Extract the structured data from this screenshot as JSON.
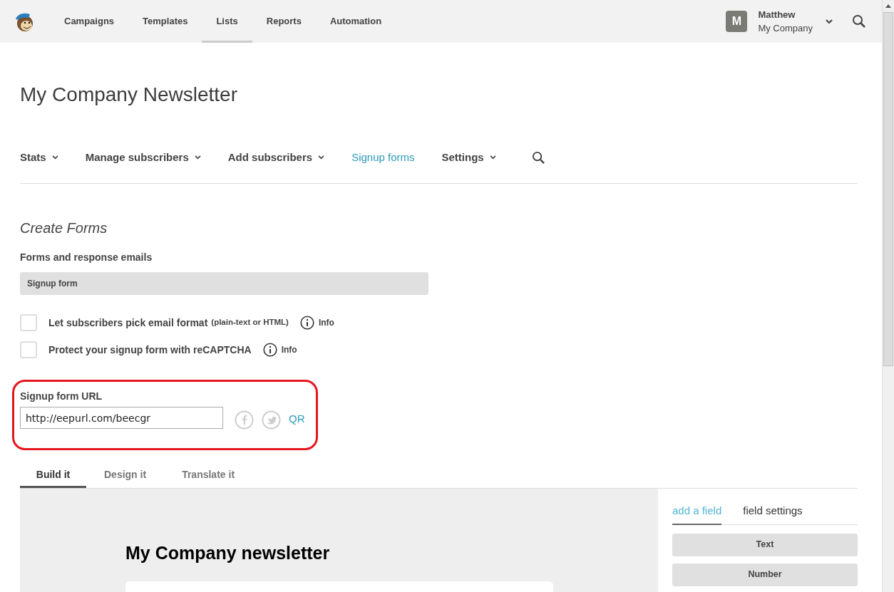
{
  "top_nav": {
    "items": [
      {
        "label": "Campaigns",
        "selected": false
      },
      {
        "label": "Templates",
        "selected": false
      },
      {
        "label": "Lists",
        "selected": true
      },
      {
        "label": "Reports",
        "selected": false
      },
      {
        "label": "Automation",
        "selected": false
      }
    ],
    "account": {
      "initial": "M",
      "name": "Matthew",
      "company": "My Company"
    }
  },
  "page_title": "My Company Newsletter",
  "sub_nav": [
    {
      "label": "Stats",
      "dropdown": true,
      "selected": false
    },
    {
      "label": "Manage subscribers",
      "dropdown": true,
      "selected": false
    },
    {
      "label": "Add subscribers",
      "dropdown": true,
      "selected": false
    },
    {
      "label": "Signup forms",
      "dropdown": false,
      "selected": true
    },
    {
      "label": "Settings",
      "dropdown": true,
      "selected": false
    }
  ],
  "section_title": "Create Forms",
  "form_select": {
    "label": "Forms and response emails",
    "value": "Signup form"
  },
  "options": [
    {
      "label": "Let subscribers pick email format",
      "note": "(plain-text or HTML)",
      "checked": false,
      "info": "Info"
    },
    {
      "label": "Protect your signup form with reCAPTCHA",
      "checked": false,
      "info": "Info"
    }
  ],
  "signup_url": {
    "label": "Signup form URL",
    "value": "http://eepurl.com/beecgr",
    "qr": "QR"
  },
  "builder_tabs": [
    {
      "label": "Build it",
      "selected": true
    },
    {
      "label": "Design it",
      "selected": false
    },
    {
      "label": "Translate it",
      "selected": false
    }
  ],
  "preview": {
    "title": "My Company newsletter"
  },
  "field_panel": {
    "tabs": [
      {
        "label": "add a field",
        "selected": true
      },
      {
        "label": "field settings",
        "selected": false
      }
    ],
    "buttons": [
      "Text",
      "Number"
    ]
  }
}
